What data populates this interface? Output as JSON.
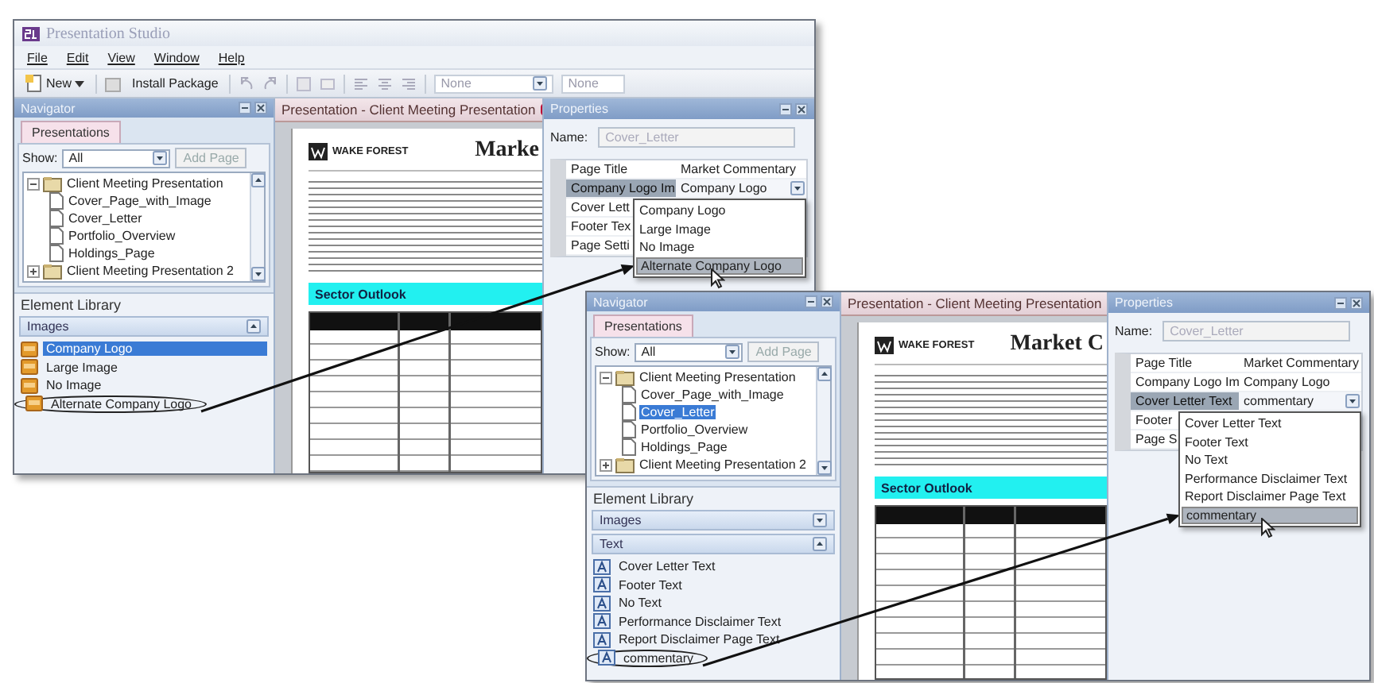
{
  "screenshots": [
    {
      "window": {
        "title": "Presentation Studio"
      },
      "menu": [
        "File",
        "Edit",
        "View",
        "Window",
        "Help"
      ],
      "toolbar": {
        "new_button": "New",
        "install_button": "Install Package",
        "style_field": "None",
        "size_field": "None"
      },
      "navigator": {
        "title": "Navigator",
        "tab": "Presentations",
        "show_label": "Show:",
        "show_value": "All",
        "add_button": "Add Page",
        "tree": [
          {
            "label": "Client Meeting Presentation",
            "expanded": true,
            "selected": false,
            "children": [
              {
                "label": "Cover_Page_with_Image",
                "selected": false
              },
              {
                "label": "Cover_Letter",
                "selected": false
              },
              {
                "label": "Portfolio_Overview",
                "selected": false
              },
              {
                "label": "Holdings_Page",
                "selected": false
              }
            ]
          },
          {
            "label": "Client Meeting Presentation 2",
            "expanded": false,
            "selected": false
          }
        ]
      },
      "library": {
        "title": "Element Library",
        "sections": [
          {
            "label": "Images",
            "kind": "image",
            "expanded": true,
            "items": [
              {
                "label": "Company Logo",
                "selected": true,
                "circled": false
              },
              {
                "label": "Large Image",
                "selected": false,
                "circled": false
              },
              {
                "label": "No Image",
                "selected": false,
                "circled": false
              },
              {
                "label": "Alternate Company Logo",
                "selected": false,
                "circled": true
              }
            ]
          }
        ]
      },
      "document": {
        "tab": "Presentation - Client Meeting Presentation",
        "logo": "WAKE FOREST",
        "heading": "Marke",
        "section": "Sector Outlook"
      },
      "properties": {
        "title": "Properties",
        "name_label": "Name:",
        "name_value": "Cover_Letter",
        "rows": [
          {
            "label": "Page Title",
            "value": "Market Commentary",
            "selected": false,
            "open": false
          },
          {
            "label": "Company Logo Im",
            "value": "Company Logo",
            "selected": true,
            "open": true
          },
          {
            "label": "Cover Lett",
            "selected": false,
            "open": false
          },
          {
            "label": "Footer Tex",
            "selected": false,
            "open": false
          },
          {
            "label": "Page Setti",
            "selected": false,
            "open": false
          }
        ],
        "dropdown": [
          {
            "label": "Company Logo",
            "selected": false
          },
          {
            "label": "Large Image",
            "selected": false
          },
          {
            "label": "No Image",
            "selected": false
          },
          {
            "label": "Alternate Company Logo",
            "selected": true
          }
        ]
      }
    },
    {
      "navigator": {
        "title": "Navigator",
        "tab": "Presentations",
        "show_label": "Show:",
        "show_value": "All",
        "add_button": "Add Page",
        "tree": [
          {
            "label": "Client Meeting Presentation",
            "expanded": true,
            "selected": false,
            "children": [
              {
                "label": "Cover_Page_with_Image",
                "selected": false
              },
              {
                "label": "Cover_Letter",
                "selected": true
              },
              {
                "label": "Portfolio_Overview",
                "selected": false
              },
              {
                "label": "Holdings_Page",
                "selected": false
              }
            ]
          },
          {
            "label": "Client Meeting Presentation 2",
            "expanded": false,
            "selected": false
          }
        ]
      },
      "library": {
        "title": "Element Library",
        "sections": [
          {
            "label": "Images",
            "expanded": false
          },
          {
            "label": "Text",
            "kind": "text",
            "expanded": true,
            "items": [
              {
                "label": "Cover Letter Text",
                "selected": false,
                "circled": false
              },
              {
                "label": "Footer Text",
                "selected": false,
                "circled": false
              },
              {
                "label": "No Text",
                "selected": false,
                "circled": false
              },
              {
                "label": "Performance Disclaimer Text",
                "selected": false,
                "circled": false
              },
              {
                "label": "Report Disclaimer Page Text",
                "selected": false,
                "circled": false
              },
              {
                "label": "commentary",
                "selected": false,
                "circled": true
              }
            ]
          }
        ]
      },
      "document": {
        "tab": "Presentation - Client Meeting Presentation",
        "logo": "WAKE FOREST",
        "heading": "Market C",
        "section": "Sector Outlook"
      },
      "properties": {
        "title": "Properties",
        "name_label": "Name:",
        "name_value": "Cover_Letter",
        "rows": [
          {
            "label": "Page Title",
            "value": "Market Commentary",
            "selected": false,
            "open": false
          },
          {
            "label": "Company Logo Im",
            "value": "Company Logo",
            "selected": false,
            "open": false
          },
          {
            "label": "Cover Letter Text",
            "value": "commentary",
            "selected": true,
            "open": true
          },
          {
            "label": "Footer",
            "selected": false,
            "open": false
          },
          {
            "label": "Page S",
            "selected": false,
            "open": false
          }
        ],
        "dropdown": [
          {
            "label": "Cover Letter Text",
            "selected": false
          },
          {
            "label": "Footer Text",
            "selected": false
          },
          {
            "label": "No Text",
            "selected": false
          },
          {
            "label": "Performance Disclaimer Text",
            "selected": false
          },
          {
            "label": "Report Disclaimer Page Text",
            "selected": false
          },
          {
            "label": "commentary",
            "selected": true
          }
        ]
      }
    }
  ]
}
